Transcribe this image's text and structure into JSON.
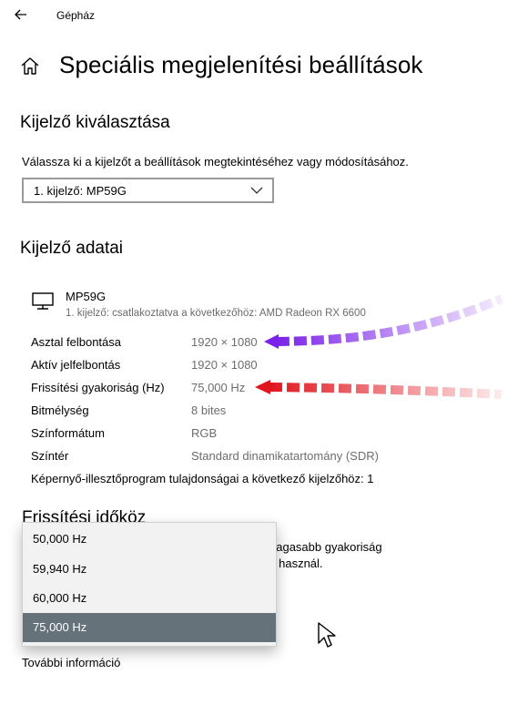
{
  "topbar": {
    "back_icon": "arrow-left-icon",
    "title": "Gépház"
  },
  "page": {
    "home_icon": "home-icon",
    "title": "Speciális megjelenítési beállítások"
  },
  "display_select": {
    "heading": "Kijelző kiválasztása",
    "description": "Válassza ki a kijelzőt a beállítások megtekintéséhez vagy módosításához.",
    "selected": "1. kijelző: MP59G"
  },
  "display_info": {
    "heading": "Kijelző adatai",
    "monitor_icon": "monitor-icon",
    "monitor_name": "MP59G",
    "monitor_sub": "1. kijelző: csatlakoztatva a következőhöz: AMD Radeon RX 6600",
    "rows": [
      {
        "label": "Asztal felbontása",
        "value": "1920 × 1080"
      },
      {
        "label": "Aktív jelfelbontás",
        "value": "1920 × 1080"
      },
      {
        "label": "Frissítési gyakoriság (Hz)",
        "value": "75,000 Hz"
      },
      {
        "label": "Bitmélység",
        "value": "8 bites"
      },
      {
        "label": "Színformátum",
        "value": "RGB"
      },
      {
        "label": "Színtér",
        "value": "Standard dinamikatartomány (SDR)"
      }
    ],
    "adapter_link": "Képernyő-illesztőprogram tulajdonságai a következő kijelzőhöz: 1"
  },
  "refresh": {
    "heading": "Frissítési időköz",
    "partial_line1": "nagasabb gyakoriság",
    "partial_line2": "s használ.",
    "options": [
      "50,000 Hz",
      "59,940 Hz",
      "60,000 Hz",
      "75,000 Hz"
    ],
    "selected_index": 3,
    "more_info": "További információ"
  },
  "annotations": {
    "purple_arrow_color": "#7b22e8",
    "red_arrow_color": "#e0151f"
  }
}
